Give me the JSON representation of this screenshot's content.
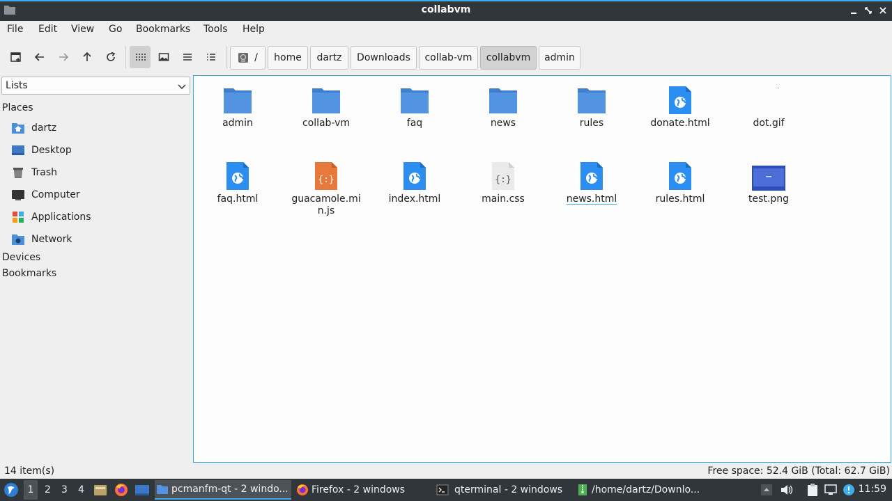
{
  "window": {
    "title": "collabvm"
  },
  "menu": [
    "File",
    "Edit",
    "View",
    "Go",
    "Bookmarks",
    "Tools",
    "Help"
  ],
  "path": {
    "root": "/",
    "crumbs": [
      "home",
      "dartz",
      "Downloads",
      "collab-vm",
      "collabvm",
      "admin"
    ],
    "current": "collabvm"
  },
  "sidebar": {
    "mode": "Lists",
    "places_header": "Places",
    "places": [
      "dartz",
      "Desktop",
      "Trash",
      "Computer",
      "Applications",
      "Network"
    ],
    "devices_header": "Devices",
    "bookmarks_header": "Bookmarks"
  },
  "files": [
    {
      "name": "admin",
      "type": "folder"
    },
    {
      "name": "collab-vm",
      "type": "folder"
    },
    {
      "name": "faq",
      "type": "folder"
    },
    {
      "name": "news",
      "type": "folder"
    },
    {
      "name": "rules",
      "type": "folder"
    },
    {
      "name": "donate.html",
      "type": "html"
    },
    {
      "name": "dot.gif",
      "type": "gif"
    },
    {
      "name": "faq.html",
      "type": "html"
    },
    {
      "name": "guacamole.min.js",
      "type": "js"
    },
    {
      "name": "index.html",
      "type": "html"
    },
    {
      "name": "main.css",
      "type": "css"
    },
    {
      "name": "news.html",
      "type": "html",
      "focused": true
    },
    {
      "name": "rules.html",
      "type": "html"
    },
    {
      "name": "test.png",
      "type": "png"
    }
  ],
  "status": {
    "items": "14 item(s)",
    "free_space": "Free space: 52.4 GiB (Total: 62.7 GiB)"
  },
  "taskbar": {
    "workspaces": [
      "1",
      "2",
      "3",
      "4"
    ],
    "active_workspace": "1",
    "tasks": [
      {
        "label": "pcmanfm-qt - 2 windo...",
        "icon": "folder-icon",
        "active": true
      },
      {
        "label": "Firefox - 2 windows",
        "icon": "firefox-icon",
        "active": false
      },
      {
        "label": "qterminal - 2 windows",
        "icon": "terminal-icon",
        "active": false
      },
      {
        "label": "/home/dartz/Downlo...",
        "icon": "archive-icon",
        "active": false
      }
    ],
    "clock": "11:59"
  },
  "colors": {
    "accent": "#3daee9",
    "folder": "#5294e2",
    "html": "#2b8ef0",
    "js": "#e8793c",
    "bar": "#31363b"
  }
}
